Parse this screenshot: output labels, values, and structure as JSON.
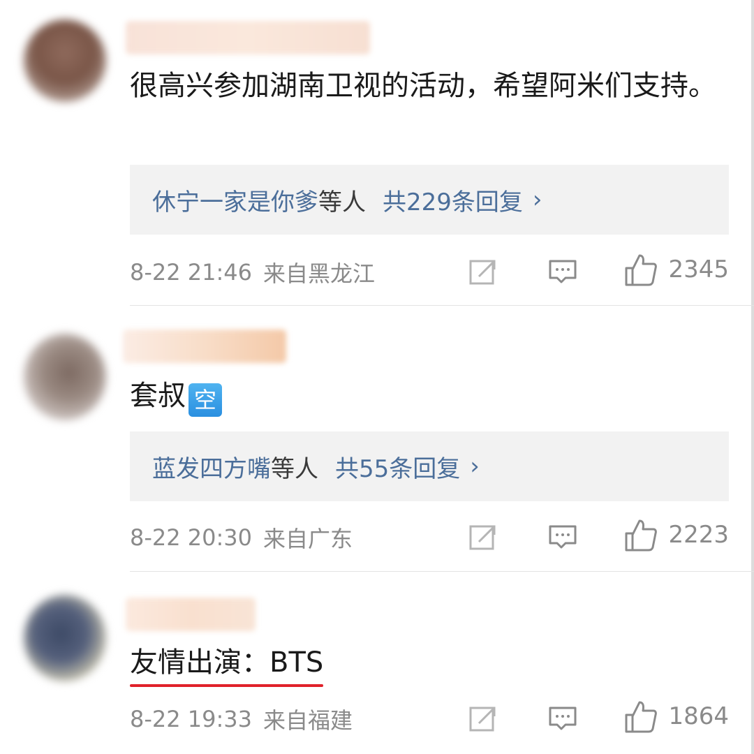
{
  "comments": [
    {
      "content": "很高兴参加湖南卫视的活动，希望阿米们支持。",
      "reply": {
        "users": "休宁一家是你爹",
        "suffix": "等人",
        "count_text": "共229条回复",
        "chevron": "›"
      },
      "time": "8-22 21:46",
      "location": "来自黑龙江",
      "likes": "2345"
    },
    {
      "content": "套叔",
      "emoji": "空",
      "reply": {
        "users": "蓝发四方嘴",
        "suffix": "等人",
        "count_text": "共55条回复",
        "chevron": "›"
      },
      "time": "8-22 20:30",
      "location": "来自广东",
      "likes": "2223"
    },
    {
      "content": "友情出演：BTS",
      "time": "8-22 19:33",
      "location": "来自福建",
      "likes": "1864"
    }
  ],
  "icons": {
    "share": "share-icon",
    "comment": "comment-icon",
    "like": "thumbs-up-icon"
  },
  "colors": {
    "link_blue": "#4b6e9a",
    "meta_gray": "#8a8a8a",
    "underline_red": "#e0212a",
    "reply_bg": "#f2f2f2"
  }
}
